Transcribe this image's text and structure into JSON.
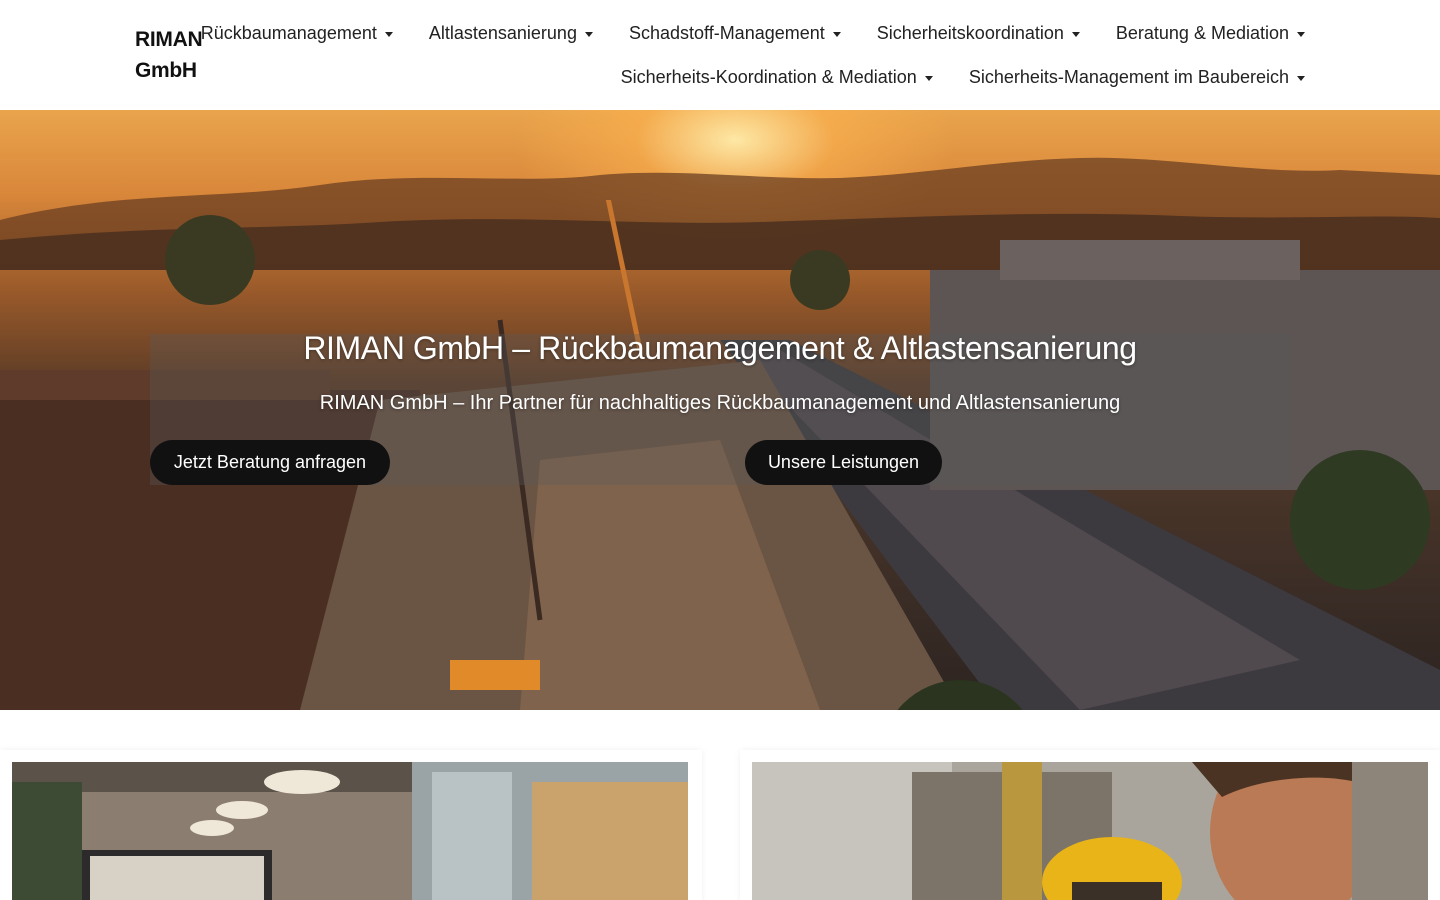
{
  "brand": {
    "name_line1": "RIMAN",
    "name_line2": "GmbH"
  },
  "nav": {
    "row1": [
      {
        "label": "Rückbaumanagement",
        "icon": "caret-down-icon"
      },
      {
        "label": "Altlastensanierung",
        "icon": "caret-down-icon"
      },
      {
        "label": "Schadstoff-Management",
        "icon": "caret-down-icon"
      },
      {
        "label": "Sicherheitskoordination",
        "icon": "caret-down-icon"
      },
      {
        "label": "Beratung & Mediation",
        "icon": "caret-down-icon"
      }
    ],
    "row2": [
      {
        "label": "Sicherheits-Koordination & Mediation",
        "icon": "caret-down-icon"
      },
      {
        "label": "Sicherheits-Management im Baubereich",
        "icon": "caret-down-icon"
      }
    ]
  },
  "hero": {
    "title": "RIMAN GmbH – Rückbaumanagement & Altlastensanierung",
    "subtitle": "RIMAN GmbH – Ihr Partner für nachhaltiges Rückbaumanagement und Altlastensanierung",
    "primary_button": "Jetzt Beratung anfragen",
    "secondary_button": "Unsere Leistungen"
  },
  "colors": {
    "button_bg": "#111111",
    "text": "#222222",
    "sunset": "#e9a44c"
  }
}
